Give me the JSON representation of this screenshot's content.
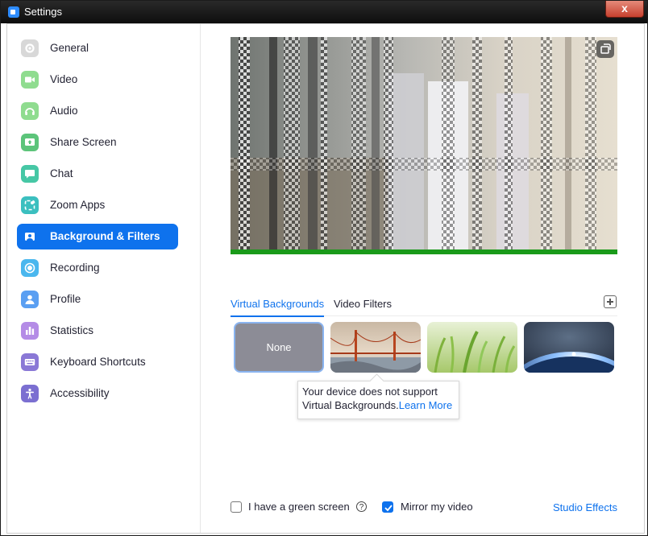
{
  "window": {
    "title": "Settings",
    "close_glyph": "x"
  },
  "sidebar": {
    "items": [
      {
        "label": "General",
        "icon": "gear-icon",
        "color": "#d5d5d5"
      },
      {
        "label": "Video",
        "icon": "video-camera-icon",
        "color": "#8fdc8f"
      },
      {
        "label": "Audio",
        "icon": "headphones-icon",
        "color": "#8fdc8f"
      },
      {
        "label": "Share Screen",
        "icon": "share-screen-icon",
        "color": "#5cc47a"
      },
      {
        "label": "Chat",
        "icon": "chat-bubble-icon",
        "color": "#46c7a5"
      },
      {
        "label": "Zoom Apps",
        "icon": "apps-icon",
        "color": "#3bbfbf"
      },
      {
        "label": "Background & Filters",
        "icon": "background-icon",
        "color": "#0e72ed"
      },
      {
        "label": "Recording",
        "icon": "record-icon",
        "color": "#4ab7ee"
      },
      {
        "label": "Profile",
        "icon": "person-icon",
        "color": "#5a9ff2"
      },
      {
        "label": "Statistics",
        "icon": "bar-chart-icon",
        "color": "#b48ce6"
      },
      {
        "label": "Keyboard Shortcuts",
        "icon": "keyboard-icon",
        "color": "#8a78d6"
      },
      {
        "label": "Accessibility",
        "icon": "accessibility-icon",
        "color": "#7b6fd1"
      }
    ],
    "selected_index": 6
  },
  "main": {
    "tabs": [
      {
        "label": "Virtual Backgrounds",
        "active": true
      },
      {
        "label": "Video Filters",
        "active": false
      }
    ],
    "backgrounds": [
      {
        "label": "None",
        "selected": true
      },
      {
        "name": "golden-gate-bridge"
      },
      {
        "name": "grass"
      },
      {
        "name": "earth-from-space"
      }
    ],
    "tooltip": {
      "line1": "Your device does not support",
      "line2": "Virtual Backgrounds.",
      "link": "Learn More"
    },
    "green_screen": {
      "label": "I have a green screen",
      "checked": false
    },
    "mirror": {
      "label": "Mirror my video",
      "checked": true
    },
    "studio_effects": "Studio Effects"
  },
  "colors": {
    "accent": "#0e72ed",
    "text": "#232333"
  }
}
